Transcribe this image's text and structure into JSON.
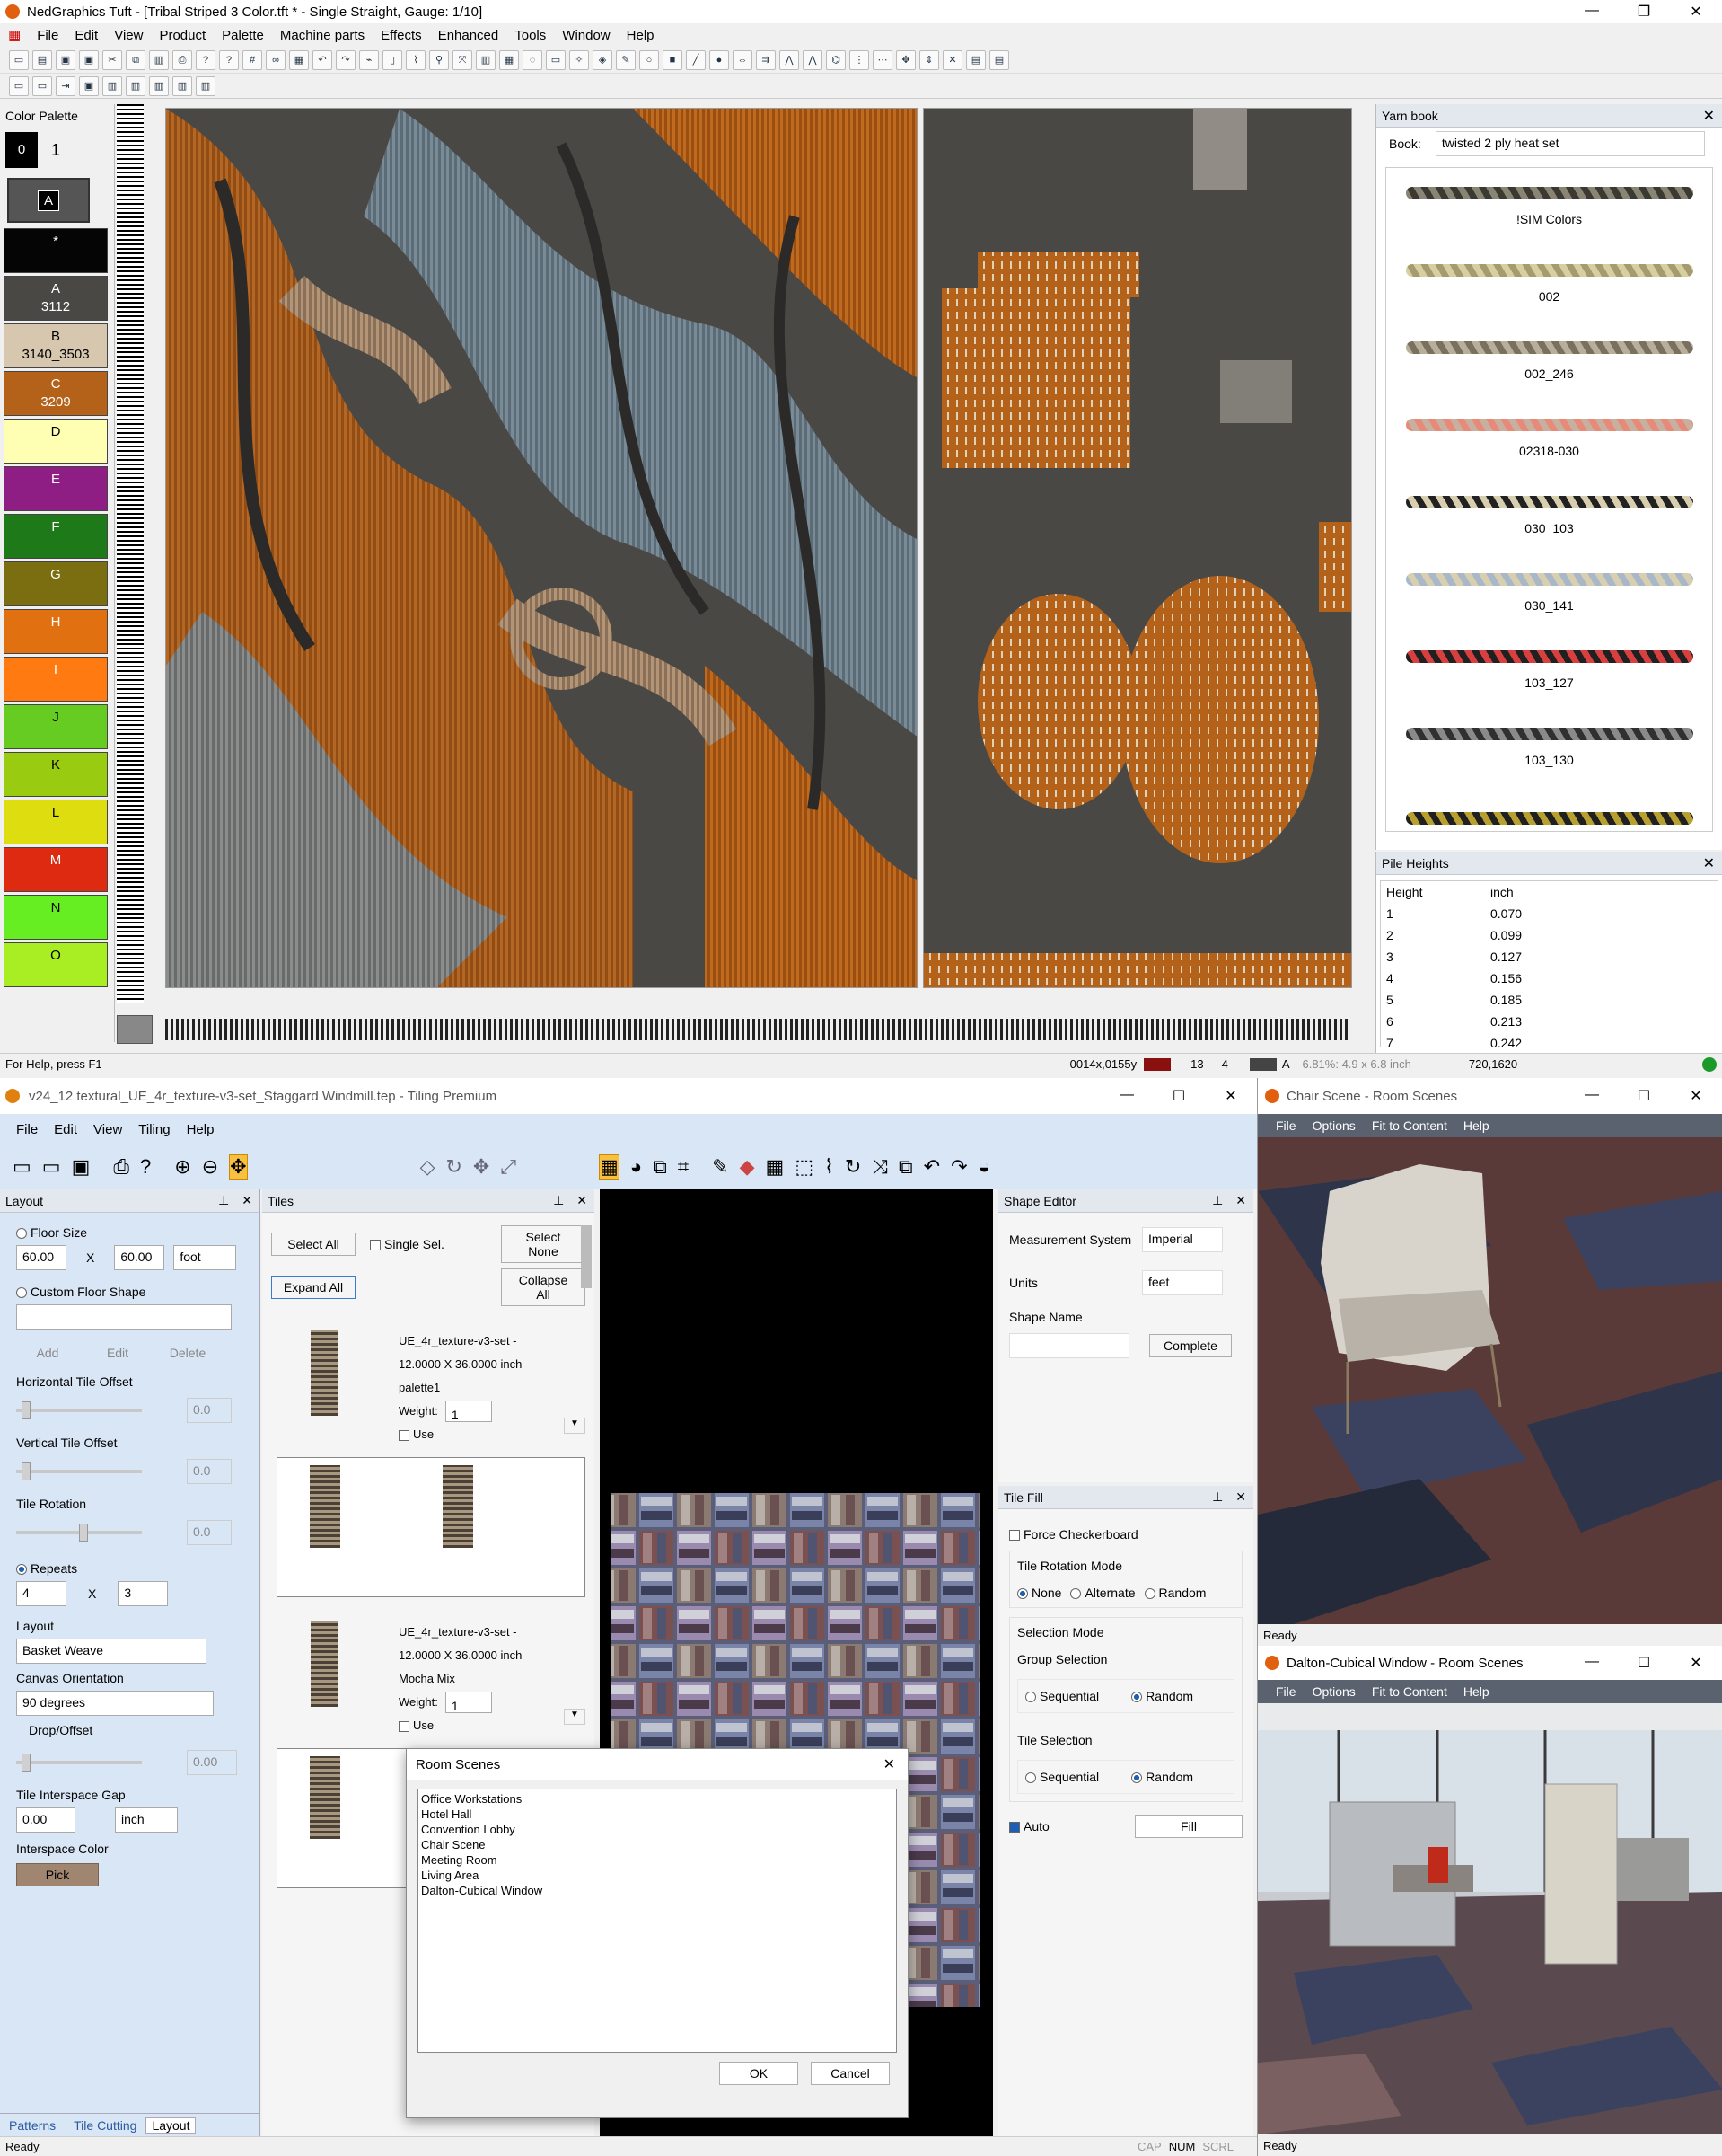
{
  "tuft": {
    "title": "NedGraphics Tuft - [Tribal Striped 3 Color.tft * - Single Straight, Gauge: 1/10]",
    "menus": [
      "File",
      "Edit",
      "View",
      "Product",
      "Palette",
      "Machine parts",
      "Effects",
      "Enhanced",
      "Tools",
      "Window",
      "Help"
    ],
    "palette": {
      "header": "Color Palette",
      "top_num": "0",
      "top_num2": "1",
      "current": "A",
      "swatches": [
        {
          "label": "*",
          "code": "",
          "color": "#050505"
        },
        {
          "label": "A",
          "code": "3112",
          "color": "#4a4845"
        },
        {
          "label": "B",
          "code": "3140_3503",
          "color": "#d6c7ae"
        },
        {
          "label": "C",
          "code": "3209",
          "color": "#b4621a"
        },
        {
          "label": "D",
          "code": "",
          "color": "#ffffb3"
        },
        {
          "label": "E",
          "code": "",
          "color": "#8f1e84"
        },
        {
          "label": "F",
          "code": "",
          "color": "#1e7a18"
        },
        {
          "label": "G",
          "code": "",
          "color": "#7a6e10"
        },
        {
          "label": "H",
          "code": "",
          "color": "#e07010"
        },
        {
          "label": "I",
          "code": "",
          "color": "#ff7a10"
        },
        {
          "label": "J",
          "code": "",
          "color": "#66cc22"
        },
        {
          "label": "K",
          "code": "",
          "color": "#99cc10"
        },
        {
          "label": "L",
          "code": "",
          "color": "#dddd10"
        },
        {
          "label": "M",
          "code": "",
          "color": "#dd2a10"
        },
        {
          "label": "N",
          "code": "",
          "color": "#66ee22"
        },
        {
          "label": "O",
          "code": "",
          "color": "#a8ee22"
        }
      ]
    },
    "yarn_book": {
      "header": "Yarn book",
      "book_label": "Book:",
      "book_value": "twisted 2 ply heat set",
      "yarns": [
        {
          "name": "!SIM Colors",
          "c1": "#8a8474",
          "c2": "#3a3a30"
        },
        {
          "name": "002",
          "c1": "#d6cfa0",
          "c2": "#a69a70"
        },
        {
          "name": "002_246",
          "c1": "#b8ae9a",
          "c2": "#7a7060"
        },
        {
          "name": "02318-030",
          "c1": "#e88a7a",
          "c2": "#c8b0a0"
        },
        {
          "name": "030_103",
          "c1": "#222",
          "c2": "#d8cfb0"
        },
        {
          "name": "030_141",
          "c1": "#a8b8c8",
          "c2": "#d8cfb0"
        },
        {
          "name": "103_127",
          "c1": "#202020",
          "c2": "#d84040"
        },
        {
          "name": "103_130",
          "c1": "#303030",
          "c2": "#8a8a8a"
        },
        {
          "name": "",
          "c1": "#202020",
          "c2": "#b8a030"
        }
      ]
    },
    "pile_heights": {
      "header": "Pile Heights",
      "col1": "Height",
      "col2": "inch",
      "rows": [
        [
          "1",
          "0.070"
        ],
        [
          "2",
          "0.099"
        ],
        [
          "3",
          "0.127"
        ],
        [
          "4",
          "0.156"
        ],
        [
          "5",
          "0.185"
        ],
        [
          "6",
          "0.213"
        ],
        [
          "7",
          "0.242"
        ]
      ]
    },
    "status": {
      "help": "For Help, press F1",
      "coords": "0014x,0155y",
      "num1": "13",
      "num2": "4",
      "letter": "A",
      "zoom": "6.81%: 4.9 x 6.8 inch",
      "size": "720,1620"
    }
  },
  "tiling": {
    "title": "v24_12 textural_UE_4r_texture-v3-set_Staggard Windmill.tep - Tiling Premium",
    "menus": [
      "File",
      "Edit",
      "View",
      "Tiling",
      "Help"
    ],
    "layout": {
      "header": "Layout",
      "floor_size": "Floor Size",
      "w": "60.00",
      "x": "X",
      "h": "60.00",
      "unit": "foot",
      "custom_shape": "Custom Floor Shape",
      "add": "Add",
      "edit": "Edit",
      "delete": "Delete",
      "h_offset": "Horizontal Tile Offset",
      "h_val": "0.0",
      "v_offset": "Vertical Tile Offset",
      "v_val": "0.0",
      "rotation": "Tile Rotation",
      "rot_val": "0.0",
      "repeats": "Repeats",
      "rep1": "4",
      "rep2": "3",
      "layout_label": "Layout",
      "layout_val": "Basket Weave",
      "canvas_orient": "Canvas Orientation",
      "orient_val": "90 degrees",
      "drop": "Drop/Offset",
      "drop_val": "0.00",
      "gap": "Tile Interspace Gap",
      "gap_val": "0.00",
      "gap_unit": "inch",
      "interspace_color": "Interspace Color",
      "pick": "Pick",
      "tabs": [
        "Patterns",
        "Tile Cutting",
        "Layout"
      ]
    },
    "tiles": {
      "header": "Tiles",
      "select_all": "Select All",
      "single_sel": "Single Sel.",
      "select_none": "Select None",
      "expand_all": "Expand All",
      "collapse_all": "Collapse All",
      "items": [
        {
          "name": "UE_4r_texture-v3-set -",
          "size": "12.0000 X 36.0000 inch",
          "palette": "palette1",
          "weight_label": "Weight:",
          "weight": "1",
          "use": "Use"
        },
        {
          "name": "UE_4r_texture-v3-set -",
          "size": "12.0000 X 36.0000 inch",
          "palette": "Mocha Mix",
          "weight_label": "Weight:",
          "weight": "1",
          "use": "Use"
        }
      ]
    },
    "shape_editor": {
      "header": "Shape Editor",
      "measurement": "Measurement System",
      "measurement_val": "Imperial",
      "units": "Units",
      "units_val": "feet",
      "shape_name": "Shape Name",
      "complete": "Complete"
    },
    "tile_fill": {
      "header": "Tile Fill",
      "force_checker": "Force Checkerboard",
      "rotation_mode": "Tile Rotation Mode",
      "none": "None",
      "alternate": "Alternate",
      "random": "Random",
      "selection_mode": "Selection Mode",
      "group_selection": "Group Selection",
      "sequential": "Sequential",
      "random2": "Random",
      "tile_selection": "Tile Selection",
      "sequential2": "Sequential",
      "random3": "Random",
      "auto": "Auto",
      "fill": "Fill"
    },
    "room_scenes_dialog": {
      "title": "Room Scenes",
      "items": [
        "Office Workstations",
        "Hotel Hall",
        "Convention Lobby",
        "Chair Scene",
        "Meeting Room",
        "Living Area",
        "Dalton-Cubical Window"
      ],
      "ok": "OK",
      "cancel": "Cancel"
    },
    "status": {
      "left": "Ready",
      "cap": "CAP",
      "num": "NUM",
      "scrl": "SCRL"
    }
  },
  "chair_scene": {
    "title": "Chair Scene - Room Scenes",
    "menus": [
      "File",
      "Options",
      "Fit to Content",
      "Help"
    ],
    "status": "Ready"
  },
  "dalton_scene": {
    "title": "Dalton-Cubical Window - Room Scenes",
    "menus": [
      "File",
      "Options",
      "Fit to Content",
      "Help"
    ],
    "status": "Ready"
  }
}
